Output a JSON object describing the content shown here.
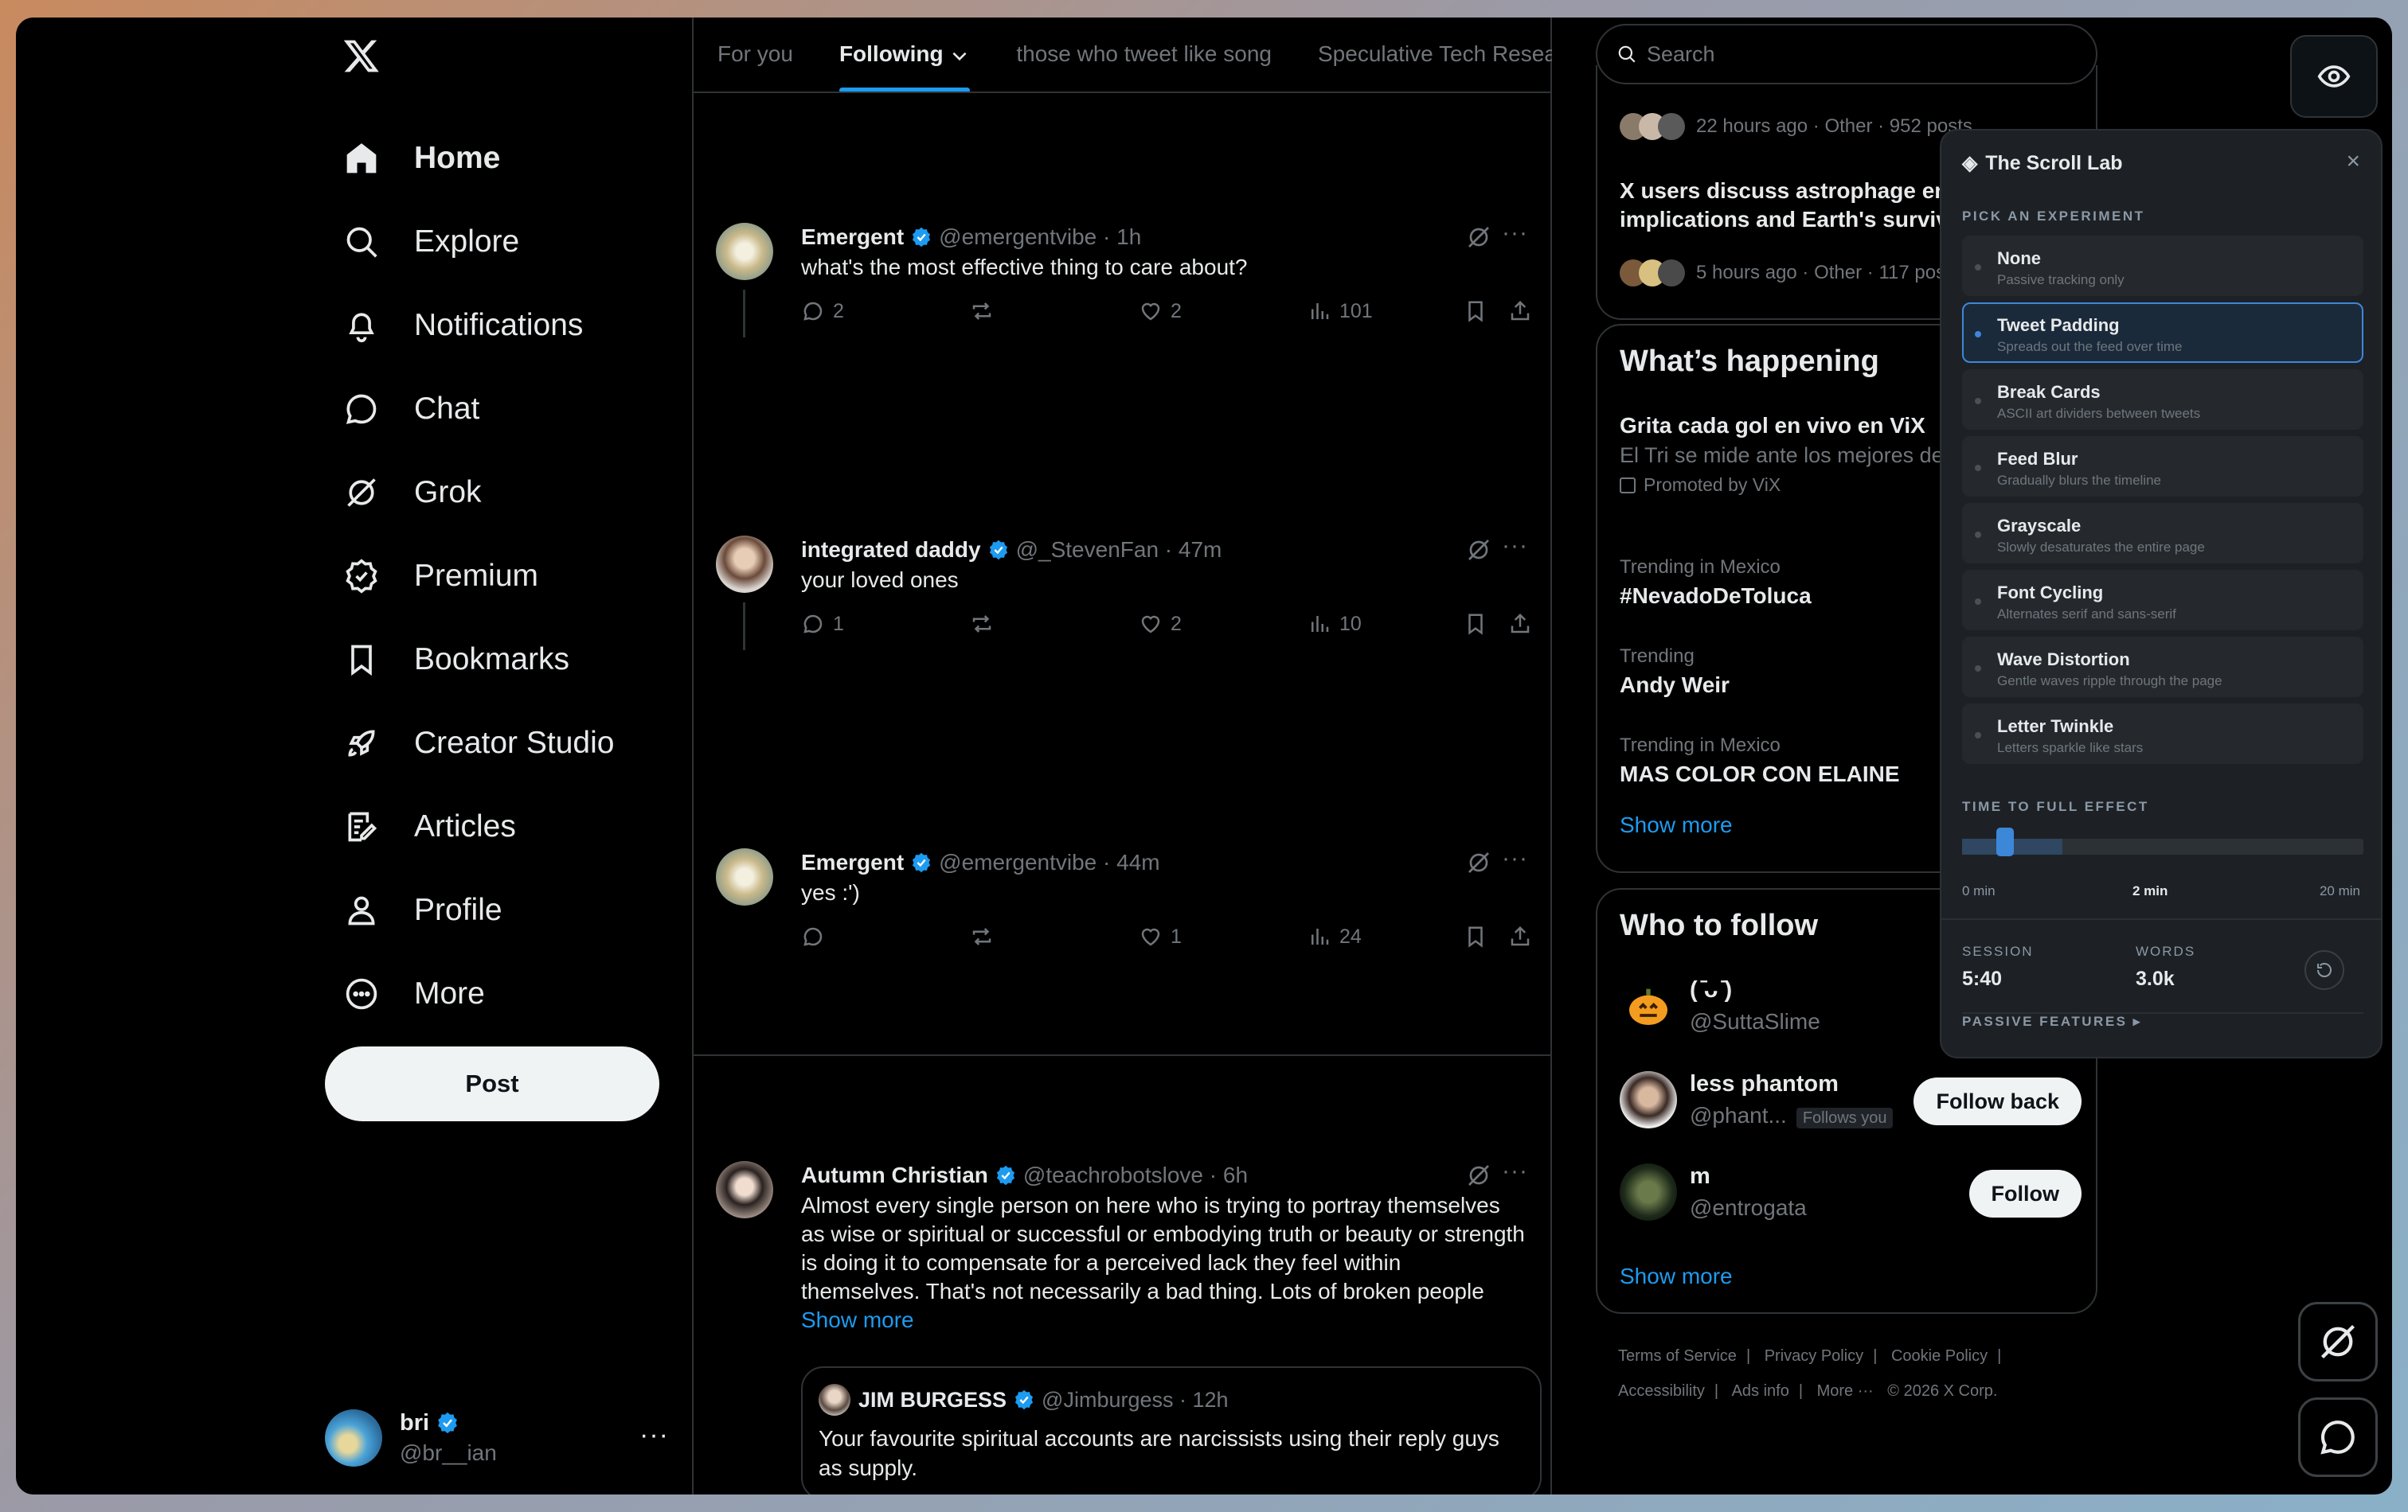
{
  "nav": {
    "items": [
      {
        "label": "Home",
        "icon": "home-icon"
      },
      {
        "label": "Explore",
        "icon": "search-icon"
      },
      {
        "label": "Notifications",
        "icon": "bell-icon"
      },
      {
        "label": "Chat",
        "icon": "chat-icon"
      },
      {
        "label": "Grok",
        "icon": "grok-icon"
      },
      {
        "label": "Premium",
        "icon": "premium-icon"
      },
      {
        "label": "Bookmarks",
        "icon": "bookmark-icon"
      },
      {
        "label": "Creator Studio",
        "icon": "rocket-icon"
      },
      {
        "label": "Articles",
        "icon": "articles-icon"
      },
      {
        "label": "Profile",
        "icon": "profile-icon"
      },
      {
        "label": "More",
        "icon": "more-circle-icon"
      }
    ],
    "post_label": "Post",
    "account": {
      "name": "bri",
      "handle": "@br__ian"
    }
  },
  "feed": {
    "tabs": [
      "For you",
      "Following",
      "those who tweet like song",
      "Speculative Tech Resea"
    ],
    "active_tab": "Following",
    "tweets": [
      {
        "name": "Emergent",
        "handle": "@emergentvibe",
        "time": "· 1h",
        "text": "what's the most effective thing to care about?",
        "replies": "2",
        "retweets": "",
        "likes": "2",
        "views": "101"
      },
      {
        "name": "integrated daddy",
        "handle": "@_StevenFan",
        "time": "· 47m",
        "text": "your loved ones",
        "replies": "1",
        "retweets": "",
        "likes": "2",
        "views": "10"
      },
      {
        "name": "Emergent",
        "handle": "@emergentvibe",
        "time": "· 44m",
        "text": "yes :')",
        "replies": "",
        "retweets": "",
        "likes": "1",
        "views": "24"
      },
      {
        "name": "Autumn Christian",
        "handle": "@teachrobotslove",
        "time": "· 6h",
        "text": "Almost every single person on here who is trying to portray themselves as wise or spiritual or successful or embodying truth or beauty or strength is doing it to compensate for a perceived lack they feel within themselves. That's not necessarily a bad thing. Lots of broken people",
        "show_more": "Show more",
        "quote": {
          "name": "JIM BURGESS",
          "handle": "@Jimburgess",
          "time": "· 12h",
          "text": "Your favourite spiritual accounts are narcissists using their reply guys as supply."
        }
      }
    ]
  },
  "right": {
    "search_placeholder": "Search",
    "top_card": {
      "meta1": "22 hours ago · Other · 952 posts",
      "headline": "X users discuss astrophage ene implications and Earth's surviva",
      "meta2": "5 hours ago · Other · 117 post"
    },
    "happening": {
      "title": "What’s happening",
      "promo_title": "Grita cada gol en vivo en ViX",
      "promo_sub": "El Tri se mide ante los mejores de",
      "promo_by": "Promoted by ViX",
      "trends": [
        {
          "label": "Trending in Mexico",
          "title": "#NevadoDeToluca"
        },
        {
          "label": "Trending",
          "title": "Andy Weir"
        },
        {
          "label": "Trending in Mexico",
          "title": "MAS COLOR CON ELAINE"
        }
      ],
      "show_more": "Show more"
    },
    "who_to_follow": {
      "title": "Who to follow",
      "users": [
        {
          "name": "( ̄ᴗ ̄)",
          "handle": "@SuttaSlime",
          "button": ""
        },
        {
          "name": "less phantom",
          "handle": "@phant...",
          "badge": "Follows you",
          "button": "Follow back"
        },
        {
          "name": "m",
          "handle": "@entrogata",
          "button": "Follow"
        }
      ],
      "show_more": "Show more"
    },
    "footer": {
      "links": [
        "Terms of Service",
        "|",
        "Privacy Policy",
        "|",
        "Cookie Policy",
        "|",
        "Accessibility",
        "|",
        "Ads info",
        "|",
        "More ···",
        "© 2026 X Corp."
      ]
    }
  },
  "lab": {
    "title": "The Scroll Lab",
    "pick_label": "PICK AN EXPERIMENT",
    "options": [
      {
        "label": "None",
        "desc": "Passive tracking only",
        "selected": false
      },
      {
        "label": "Tweet Padding",
        "desc": "Spreads out the feed over time",
        "selected": true
      },
      {
        "label": "Break Cards",
        "desc": "ASCII art dividers between tweets",
        "selected": false
      },
      {
        "label": "Feed Blur",
        "desc": "Gradually blurs the timeline",
        "selected": false
      },
      {
        "label": "Grayscale",
        "desc": "Slowly desaturates the entire page",
        "selected": false
      },
      {
        "label": "Font Cycling",
        "desc": "Alternates serif and sans-serif",
        "selected": false
      },
      {
        "label": "Wave Distortion",
        "desc": "Gentle waves ripple through the page",
        "selected": false
      },
      {
        "label": "Letter Twinkle",
        "desc": "Letters sparkle like stars",
        "selected": false
      }
    ],
    "time_label": "TIME TO FULL EFFECT",
    "time_value_min": 2,
    "time_max_min": 20,
    "ticks": [
      "0 min",
      "2 min",
      "20 min"
    ],
    "session_label": "SESSION",
    "session_value": "5:40",
    "words_label": "WORDS",
    "words_value": "3.0k",
    "passive_label": "PASSIVE FEATURES ▸"
  },
  "colors": {
    "accent": "#1d9bf0",
    "background": "#000000",
    "border": "#2f3336",
    "muted": "#71767b",
    "lab_accent": "#3d87d9"
  }
}
